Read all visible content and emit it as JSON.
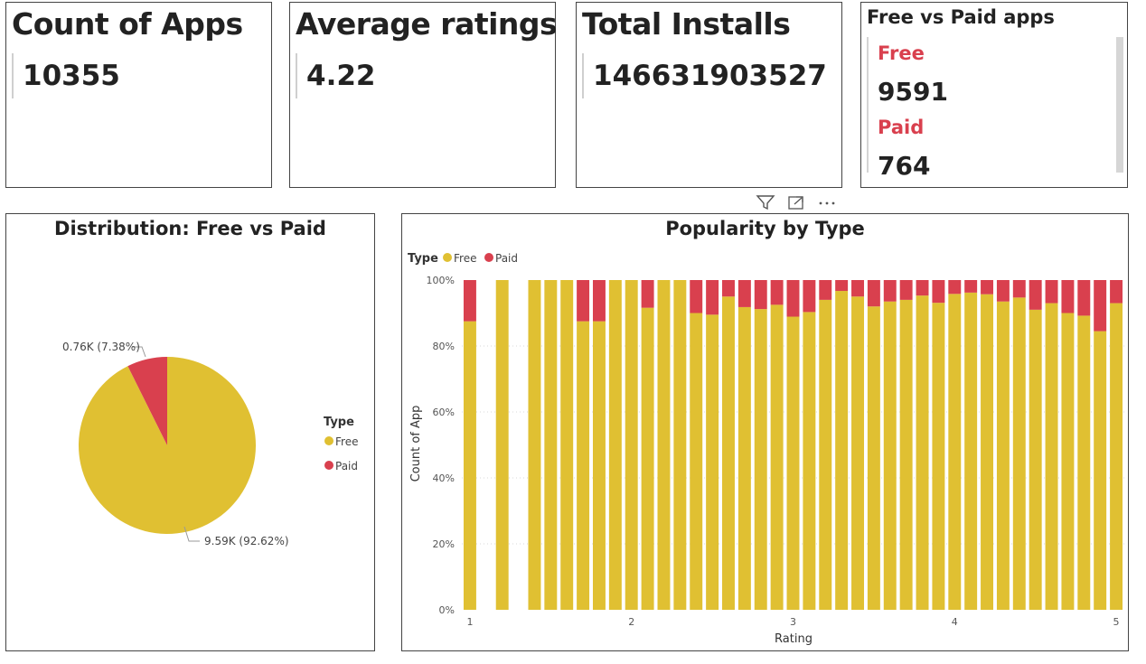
{
  "kpis": [
    {
      "title": "Count of Apps",
      "value": "10355"
    },
    {
      "title": "Average ratings",
      "value": "4.22"
    },
    {
      "title": "Total Installs",
      "value": "146631903527"
    }
  ],
  "free_vs_paid": {
    "title": "Free vs Paid apps",
    "free_label": "Free",
    "free_value": "9591",
    "paid_label": "Paid",
    "paid_value": "764"
  },
  "toolbar": {
    "filter_icon": "filter-icon",
    "focus_icon": "focus-mode-icon",
    "more_icon": "more-options-icon",
    "more_label": "···"
  },
  "pie": {
    "title": "Distribution: Free vs Paid",
    "legend_title": "Type",
    "legend": [
      "Free",
      "Paid"
    ],
    "paid_label": "0.76K (7.38%)",
    "free_label": "9.59K (92.62%)"
  },
  "bar": {
    "title": "Popularity by Type",
    "legend_title": "Type",
    "legend": [
      "Free",
      "Paid"
    ],
    "xlabel": "Rating",
    "ylabel": "Count of App",
    "yticks": [
      "0%",
      "20%",
      "40%",
      "60%",
      "80%",
      "100%"
    ],
    "xticks": [
      "1",
      "2",
      "3",
      "4",
      "5"
    ]
  },
  "colors": {
    "free": "#e0c032",
    "paid": "#d9404e"
  },
  "chart_data": [
    {
      "type": "pie",
      "title": "Distribution: Free vs Paid",
      "categories": [
        "Free",
        "Paid"
      ],
      "values": [
        9590,
        760
      ],
      "percents": [
        92.62,
        7.38
      ]
    },
    {
      "type": "bar",
      "stacked": "100%",
      "title": "Popularity by Type",
      "xlabel": "Rating",
      "ylabel": "Count of App",
      "ylim": [
        0,
        100
      ],
      "x": [
        1.0,
        1.1,
        1.2,
        1.3,
        1.4,
        1.5,
        1.6,
        1.7,
        1.8,
        1.9,
        2.0,
        2.1,
        2.2,
        2.3,
        2.4,
        2.5,
        2.6,
        2.7,
        2.8,
        2.9,
        3.0,
        3.1,
        3.2,
        3.3,
        3.4,
        3.5,
        3.6,
        3.7,
        3.8,
        3.9,
        4.0,
        4.1,
        4.2,
        4.3,
        4.4,
        4.5,
        4.6,
        4.7,
        4.8,
        4.9,
        5.0
      ],
      "series": [
        {
          "name": "Free",
          "values": [
            87.5,
            0,
            100,
            0,
            100,
            100,
            100,
            87.5,
            87.5,
            100,
            100,
            91.6,
            100,
            100,
            90,
            89.5,
            95,
            91.8,
            91.2,
            92.5,
            88.9,
            90.3,
            94,
            96.7,
            95,
            92,
            93.5,
            94,
            95.3,
            93.1,
            95.8,
            96.2,
            95.7,
            93.5,
            94.7,
            91,
            93,
            90,
            89.2,
            84.5,
            93
          ],
          "extra": [
            89.5
          ]
        },
        {
          "name": "Paid",
          "values": [
            12.5,
            0,
            0,
            0,
            0,
            0,
            0,
            12.5,
            12.5,
            0,
            0,
            8.4,
            0,
            0,
            10,
            10.5,
            5,
            8.2,
            8.8,
            7.5,
            11.1,
            9.7,
            6,
            3.3,
            5,
            8,
            6.5,
            6,
            4.7,
            6.9,
            4.2,
            3.8,
            4.3,
            6.5,
            5.3,
            9,
            7,
            10,
            10.8,
            15.5,
            7
          ]
        }
      ]
    }
  ]
}
